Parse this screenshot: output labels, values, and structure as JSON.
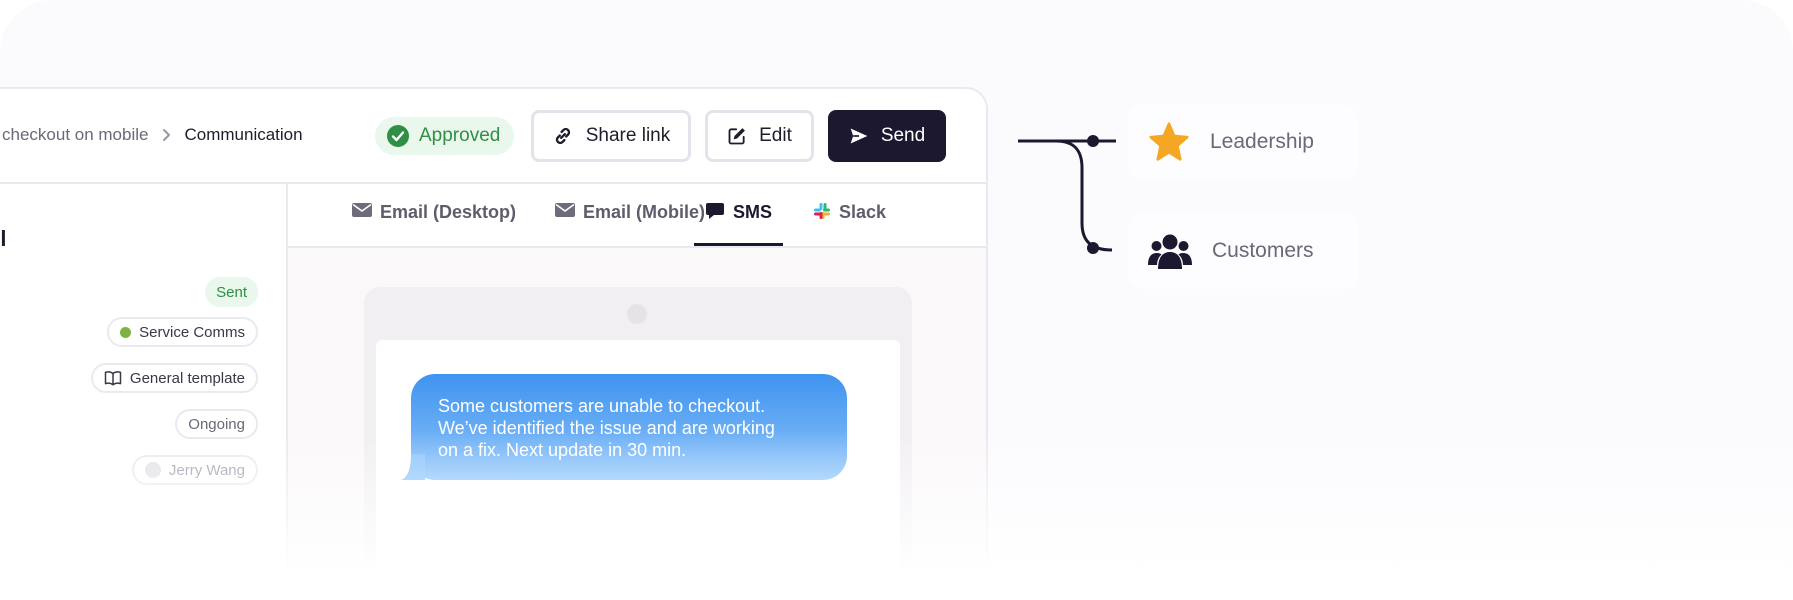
{
  "breadcrumb": {
    "parent": "checkout on mobile",
    "current": "Communication"
  },
  "status": {
    "label": "Approved",
    "color": "#2f8f44"
  },
  "actions": {
    "share_label": "Share link",
    "edit_label": "Edit",
    "send_label": "Send"
  },
  "sidebar": {
    "title": "ail",
    "pills": {
      "sent": "Sent",
      "service": "Service Comms",
      "template": "General template",
      "ongoing": "Ongoing",
      "owner": "Jerry Wang"
    }
  },
  "tabs": [
    {
      "label": "Email (Desktop)",
      "icon": "envelope-icon"
    },
    {
      "label": "Email (Mobile)",
      "icon": "envelope-icon"
    },
    {
      "label": "SMS",
      "icon": "chat-bubble-icon",
      "active": true
    },
    {
      "label": "Slack",
      "icon": "slack-icon"
    }
  ],
  "sms_message": {
    "line1": "Some customers are unable to checkout.",
    "line2": "We’ve identified the issue and are working",
    "line3": "on a fix. Next update in 30 min."
  },
  "audiences": [
    {
      "label": "Leadership",
      "icon": "star-icon",
      "color": "#f5a623"
    },
    {
      "label": "Customers",
      "icon": "users-icon",
      "color": "#1b1830"
    }
  ],
  "colors": {
    "primary_dark": "#1b1830",
    "success": "#2f8f44",
    "bubble_blue": "#3f93ef"
  }
}
